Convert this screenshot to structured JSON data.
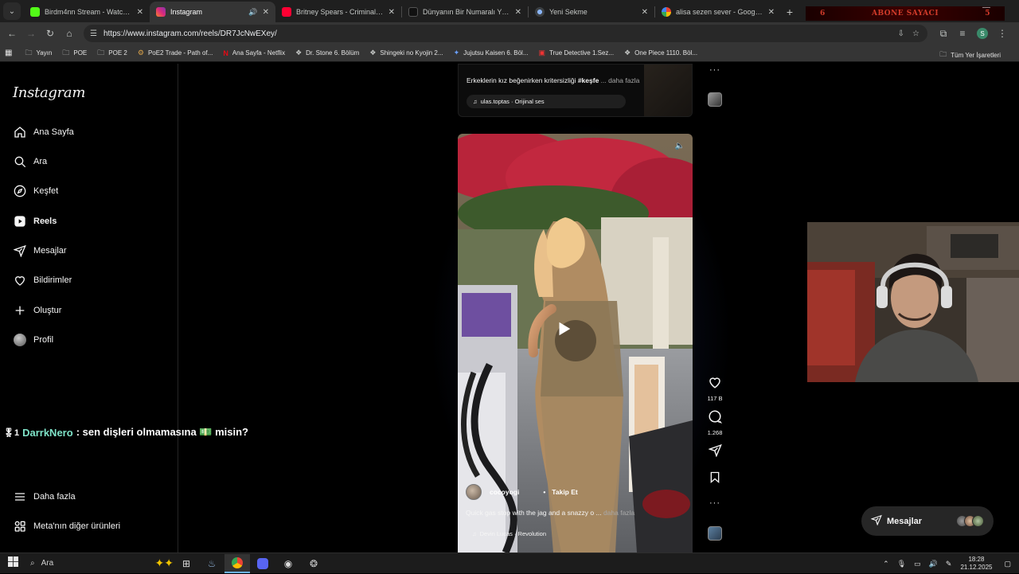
{
  "browser": {
    "tabs": [
      {
        "title": "Birdm4nn Stream - Watch Live",
        "favicon_color": "#53fc18",
        "active": false,
        "audio": false
      },
      {
        "title": "Instagram",
        "favicon_color": "#d6249f",
        "active": true,
        "audio": true
      },
      {
        "title": "Britney Spears - Criminal (Offic",
        "favicon_color": "#ff0033",
        "active": false,
        "audio": false
      },
      {
        "title": "Dünyanın Bir Numaralı Yıldızıyı",
        "favicon_color": "#000000",
        "active": false,
        "audio": false
      },
      {
        "title": "Yeni Sekme",
        "favicon_color": "#8ab4f8",
        "active": false,
        "audio": false
      },
      {
        "title": "alisa sezen sever - Google'da A",
        "favicon_color": "#4285f4",
        "active": false,
        "audio": false
      }
    ],
    "abone_counter": {
      "label": "ABONE SAYACI",
      "left": "6",
      "right": "5"
    },
    "url": "https://www.instagram.com/reels/DR7JcNwEXey/",
    "profile_letter": "S",
    "bookmarks": [
      {
        "label": "Yayın",
        "icon": "folder-icon"
      },
      {
        "label": "POE",
        "icon": "folder-icon"
      },
      {
        "label": "POE 2",
        "icon": "folder-icon"
      },
      {
        "label": "PoE2 Trade - Path of...",
        "icon": "site-icon"
      },
      {
        "label": "Ana Sayfa - Netflix",
        "icon": "netflix-icon"
      },
      {
        "label": "Dr. Stone 6. Bölüm",
        "icon": "site-icon"
      },
      {
        "label": "Shingeki no Kyojin 2...",
        "icon": "site-icon"
      },
      {
        "label": "Jujutsu Kaisen 6. Böl...",
        "icon": "site-icon"
      },
      {
        "label": "True Detective 1.Sez...",
        "icon": "site-icon"
      },
      {
        "label": "One Piece 1110. Böl...",
        "icon": "site-icon"
      }
    ],
    "all_bookmarks": "Tüm Yer İşaretleri"
  },
  "instagram": {
    "logo": "Instagram",
    "nav": {
      "home": "Ana Sayfa",
      "search": "Ara",
      "explore": "Keşfet",
      "reels": "Reels",
      "messages": "Mesajlar",
      "notifications": "Bildirimler",
      "create": "Oluştur",
      "profile": "Profil",
      "more": "Daha fazla",
      "meta": "Meta'nın diğer ürünleri"
    },
    "prev_reel": {
      "caption_text": "Erkeklerin kız beğenirken kritersizliği ",
      "caption_tag": "#keşfe",
      "caption_more": " ... daha fazla",
      "audio": "ulas.toptas · Orijinal ses"
    },
    "reel": {
      "username": "cocoyogi",
      "follow": "Takip Et",
      "caption": "Quick gas stop with the jag and a snazzy o ...",
      "caption_more": " daha fazla",
      "audio": "Devin Lucas · Revolution",
      "likes": "117 B",
      "comments": "1.268"
    },
    "messages_pill": "Mesajlar"
  },
  "chat_overlay": {
    "badge": "1",
    "user": "DarrkNero",
    "message": ": sen dişleri olmamasına 💵 misin?"
  },
  "taskbar": {
    "search_placeholder": "Ara",
    "time": "18:28",
    "date": "21.12.2025"
  }
}
